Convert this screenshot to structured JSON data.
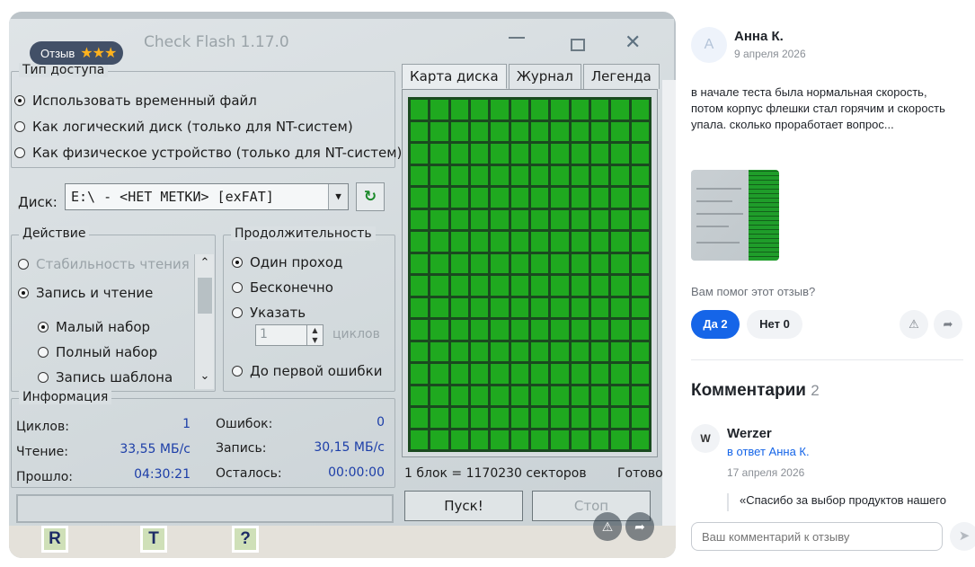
{
  "photo": {
    "badge_label": "Отзыв",
    "stars": "★★★",
    "actions": {
      "report_icon": "warning-icon",
      "share_icon": "share-icon"
    },
    "app": {
      "title": "Check Flash 1.17.0",
      "access_group": {
        "label": "Тип доступа",
        "options": [
          {
            "label": "Использовать временный файл",
            "selected": true
          },
          {
            "label": "Как логический диск (только для NT-систем)",
            "selected": false
          },
          {
            "label": "Как физическое устройство (только для NT-систем)",
            "selected": false
          }
        ]
      },
      "disk": {
        "label": "Диск:",
        "value": "E:\\ - <НЕТ МЕТКИ> [exFAT]"
      },
      "action_group": {
        "label": "Действие",
        "options": [
          {
            "label": "Стабильность чтения",
            "selected": false,
            "disabled": true
          },
          {
            "label": "Запись и чтение",
            "selected": true
          },
          {
            "label": "Малый набор",
            "selected": true
          },
          {
            "label": "Полный набор",
            "selected": false
          },
          {
            "label": "Запись шаблона",
            "selected": false
          }
        ]
      },
      "duration_group": {
        "label": "Продолжительность",
        "options": [
          {
            "label": "Один проход",
            "selected": true
          },
          {
            "label": "Бесконечно",
            "selected": false
          },
          {
            "label": "Указать",
            "selected": false
          },
          {
            "label": "До первой ошибки",
            "selected": false
          }
        ],
        "cycles_value": "1",
        "cycles_unit": "циклов"
      },
      "info": {
        "label": "Информация",
        "rows": [
          {
            "label": "Циклов:",
            "value": "1"
          },
          {
            "label": "Чтение:",
            "value": "33,55 МБ/с"
          },
          {
            "label": "Прошло:",
            "value": "04:30:21"
          },
          {
            "label": "Ошибок:",
            "value": "0"
          },
          {
            "label": "Запись:",
            "value": "30,15 МБ/с"
          },
          {
            "label": "Осталось:",
            "value": "00:00:00"
          }
        ]
      },
      "tabs": [
        "Карта диска",
        "Журнал",
        "Легенда"
      ],
      "map": {
        "rows": 16,
        "cols": 12,
        "color": "#1fa91f"
      },
      "block_info": "1 блок = 1170230 секторов",
      "status": "Готово",
      "start_button": "Пуск!",
      "stop_button": "Стоп",
      "taskbar_tiles": [
        "R",
        "T",
        "?"
      ]
    }
  },
  "review": {
    "avatar_letter": "А",
    "author": "Анна К.",
    "date": "9 апреля 2026",
    "text": "в начале теста была нормальная скорость, потом корпус флешки стал горячим и скорость упала. сколько проработает вопрос...",
    "helpful_question": "Вам помог этот отзыв?",
    "yes_label": "Да 2",
    "no_label": "Нет 0",
    "report_icon": "warning-icon",
    "share_icon": "share-icon"
  },
  "comments": {
    "title": "Комментарии",
    "count": "2",
    "items": [
      {
        "avatar_letter": "W",
        "author": "Werzer",
        "reply_to": "в ответ Анна К.",
        "date": "17 апреля 2026",
        "text": "«Спасибо за выбор продуктов нашего"
      }
    ],
    "input_placeholder": "Ваш комментарий к отзыву",
    "send_icon": "send-icon"
  },
  "colors": {
    "accent": "#1565e8",
    "map_green": "#1fa91f",
    "star": "#ffb21d"
  }
}
